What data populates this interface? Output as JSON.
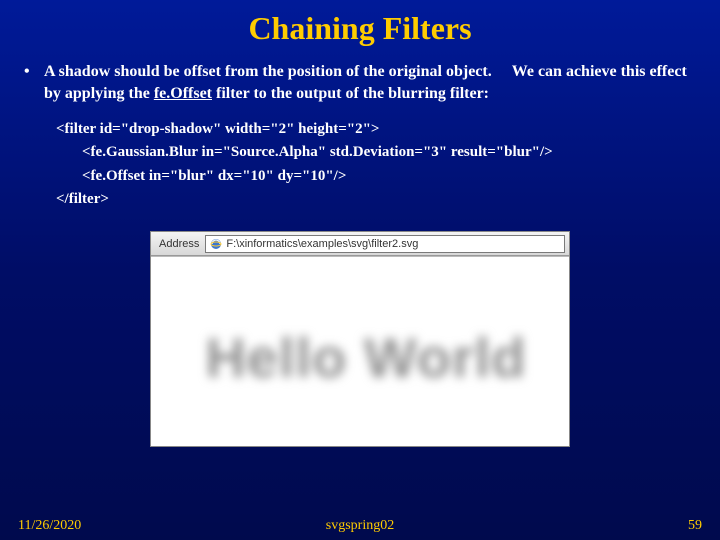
{
  "title": "Chaining Filters",
  "bullet": {
    "part1": "A shadow should be offset from the position of the original object.",
    "part2": "We can achieve this effect by applying the ",
    "underlined": "fe.Offset",
    "part3": " filter to the output of the blurring filter:"
  },
  "code": {
    "line1": "<filter id=\"drop-shadow\" width=\"2\" height=\"2\">",
    "line2": "<fe.Gaussian.Blur in=\"Source.Alpha\" std.Deviation=\"3\" result=\"blur\"/>",
    "line3": "<fe.Offset in=\"blur\" dx=\"10\" dy=\"10\"/>",
    "line4": "</filter>"
  },
  "browser": {
    "address_label": "Address",
    "path": "F:\\xinformatics\\examples\\svg\\filter2.svg"
  },
  "example_text": "Hello World",
  "footer": {
    "date": "11/26/2020",
    "center": "svgspring02",
    "page": "59"
  }
}
